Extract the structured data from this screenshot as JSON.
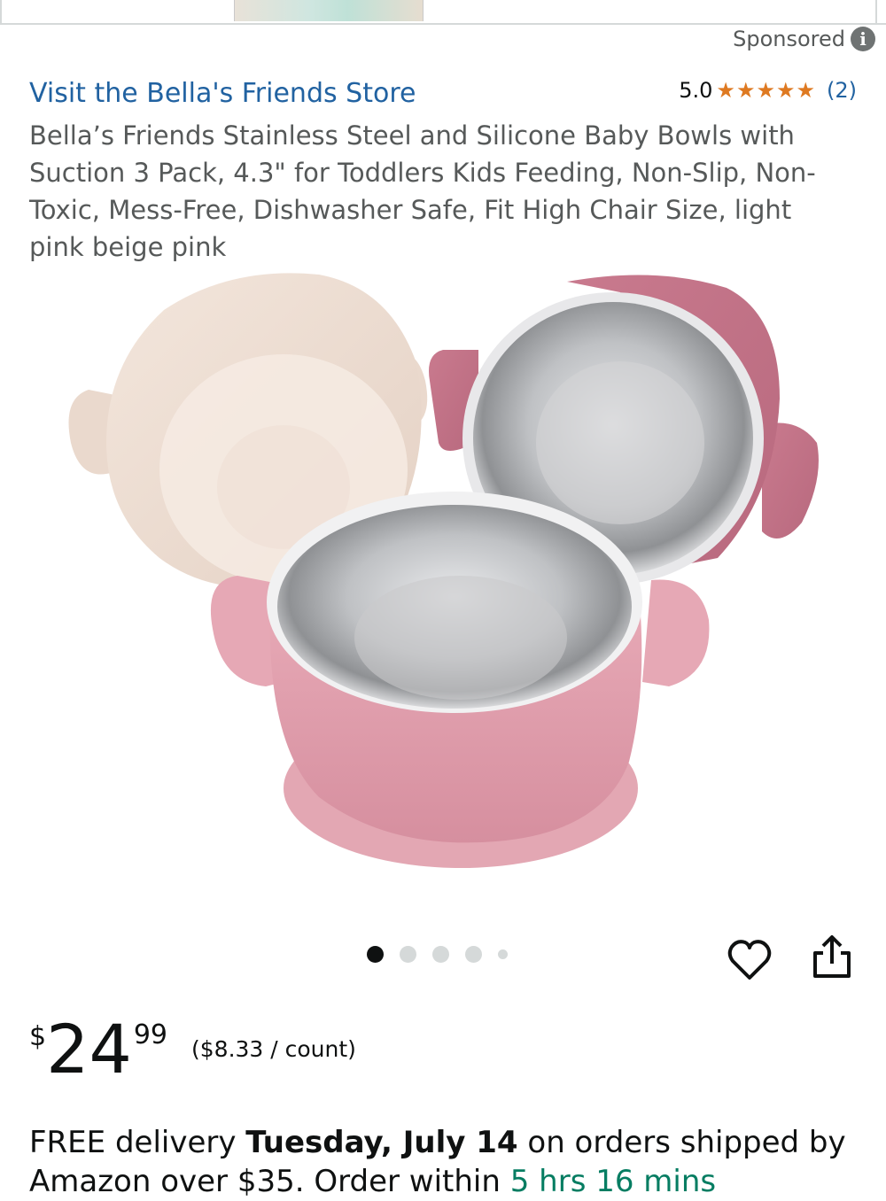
{
  "sponsored": {
    "label": "Sponsored",
    "icon": "info-icon"
  },
  "store": {
    "link_text": "Visit the Bella's Friends Store"
  },
  "rating": {
    "score": "5.0",
    "stars": "★★★★★",
    "stars_value": 5,
    "count": "(2)"
  },
  "product": {
    "title": "Bella’s Friends Stainless Steel and Silicone Baby Bowls with Suction 3 Pack, 4.3\" for Toddlers Kids Feeding, Non-Slip, Non-Toxic, Mess-Free, Dishwasher Safe, Fit High Chair Size, light pink beige pink"
  },
  "carousel": {
    "total": 5,
    "active": 1
  },
  "actions": {
    "favorite_icon": "heart-icon",
    "share_icon": "share-icon"
  },
  "price": {
    "symbol": "$",
    "whole": "24",
    "fraction": "99",
    "unit": "($8.33 / count)"
  },
  "delivery": {
    "prefix": "FREE delivery ",
    "date": "Tuesday, July 14",
    "suffix": " on orders shipped by Amazon over $35. Order within ",
    "countdown": "5 hrs 16 mins"
  },
  "colors": {
    "link": "#2162a1",
    "star": "#de7921",
    "text": "#0f1111",
    "muted": "#565959"
  }
}
